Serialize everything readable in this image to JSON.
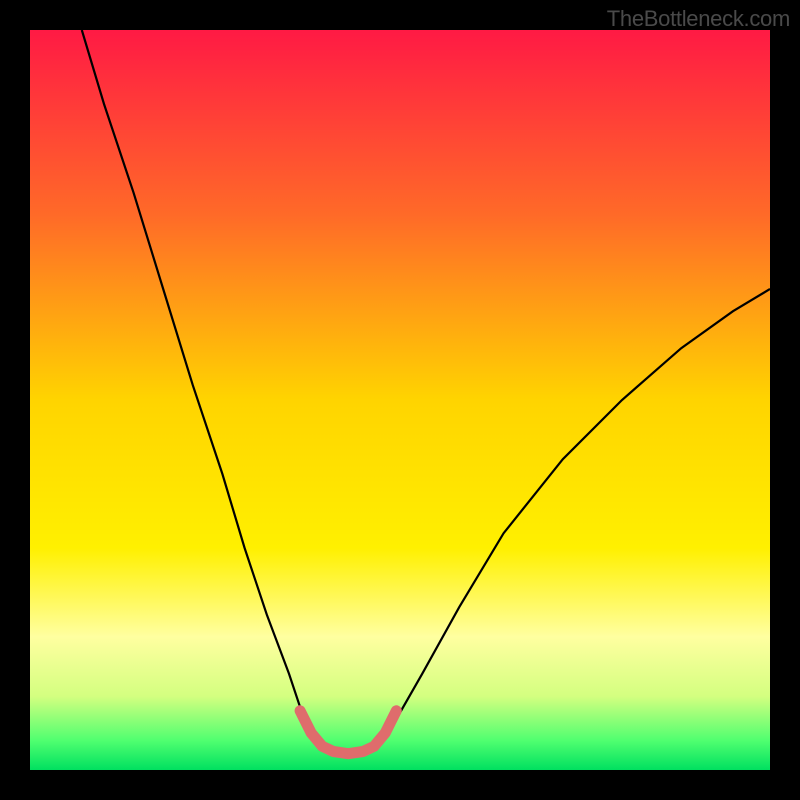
{
  "watermark": "TheBottleneck.com",
  "chart_data": {
    "type": "line",
    "title": "",
    "xlabel": "",
    "ylabel": "",
    "xlim": [
      0,
      100
    ],
    "ylim": [
      0,
      100
    ],
    "gradient_stops": [
      {
        "offset": 0,
        "color": "#ff1a44"
      },
      {
        "offset": 25,
        "color": "#ff6a28"
      },
      {
        "offset": 50,
        "color": "#ffd400"
      },
      {
        "offset": 70,
        "color": "#fff000"
      },
      {
        "offset": 82,
        "color": "#ffffa0"
      },
      {
        "offset": 90,
        "color": "#d4ff80"
      },
      {
        "offset": 96,
        "color": "#50ff70"
      },
      {
        "offset": 100,
        "color": "#00e060"
      }
    ],
    "series": [
      {
        "name": "bottleneck-curve",
        "color": "#000000",
        "points": [
          {
            "x": 7,
            "y": 100
          },
          {
            "x": 10,
            "y": 90
          },
          {
            "x": 14,
            "y": 78
          },
          {
            "x": 18,
            "y": 65
          },
          {
            "x": 22,
            "y": 52
          },
          {
            "x": 26,
            "y": 40
          },
          {
            "x": 29,
            "y": 30
          },
          {
            "x": 32,
            "y": 21
          },
          {
            "x": 35,
            "y": 13
          },
          {
            "x": 37,
            "y": 7
          },
          {
            "x": 39,
            "y": 3.5
          },
          {
            "x": 41,
            "y": 2.5
          },
          {
            "x": 43,
            "y": 2.2
          },
          {
            "x": 45,
            "y": 2.5
          },
          {
            "x": 47,
            "y": 3.5
          },
          {
            "x": 49,
            "y": 6
          },
          {
            "x": 53,
            "y": 13
          },
          {
            "x": 58,
            "y": 22
          },
          {
            "x": 64,
            "y": 32
          },
          {
            "x": 72,
            "y": 42
          },
          {
            "x": 80,
            "y": 50
          },
          {
            "x": 88,
            "y": 57
          },
          {
            "x": 95,
            "y": 62
          },
          {
            "x": 100,
            "y": 65
          }
        ]
      },
      {
        "name": "valley-highlight",
        "color": "#e06a6a",
        "points": [
          {
            "x": 36.5,
            "y": 8
          },
          {
            "x": 38,
            "y": 5
          },
          {
            "x": 39.5,
            "y": 3.2
          },
          {
            "x": 41,
            "y": 2.5
          },
          {
            "x": 43,
            "y": 2.2
          },
          {
            "x": 45,
            "y": 2.5
          },
          {
            "x": 46.5,
            "y": 3.2
          },
          {
            "x": 48,
            "y": 5
          },
          {
            "x": 49.5,
            "y": 8
          }
        ]
      }
    ]
  }
}
